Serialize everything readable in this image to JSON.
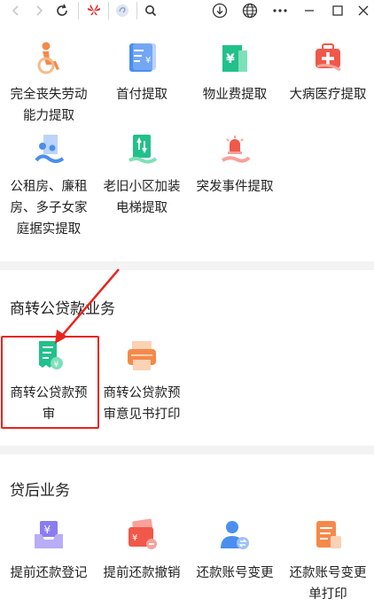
{
  "toolbar": {
    "icons": [
      "back-arrow-icon",
      "forward-arrow-icon",
      "reload-icon",
      "huawei-logo-icon",
      "spiral-logo-icon",
      "search-icon",
      "download-icon",
      "globe-icon",
      "more-icon",
      "minimize-icon",
      "maximize-icon",
      "close-icon"
    ]
  },
  "section1": {
    "row1": [
      {
        "label": "完全丧失劳动能力提取",
        "icon": "wheelchair-icon"
      },
      {
        "label": "首付提取",
        "icon": "yen-document-icon"
      },
      {
        "label": "物业费提取",
        "icon": "yen-building-icon"
      },
      {
        "label": "大病医疗提取",
        "icon": "medical-kit-icon"
      }
    ],
    "row2": [
      {
        "label": "公租房、廉租房、多子女家庭据实提取",
        "icon": "housing-family-icon"
      },
      {
        "label": "老旧小区加装电梯提取",
        "icon": "elevator-icon"
      },
      {
        "label": "突发事件提取",
        "icon": "alarm-hand-icon"
      }
    ]
  },
  "section2": {
    "title": "商转公贷款业务",
    "items": [
      {
        "label": "商转公贷款预审",
        "icon": "receipt-yen-icon"
      },
      {
        "label": "商转公贷款预审意见书打印",
        "icon": "printer-icon"
      }
    ]
  },
  "section3": {
    "title": "贷后业务",
    "items": [
      {
        "label": "提前还款登记",
        "icon": "yen-inbox-icon"
      },
      {
        "label": "提前还款撤销",
        "icon": "card-cancel-icon"
      },
      {
        "label": "还款账号变更",
        "icon": "user-exchange-icon"
      },
      {
        "label": "还款账号变更单打印",
        "icon": "document-print-icon"
      }
    ]
  },
  "colors": {
    "orange": "#f5894a",
    "blue": "#4a8ef0",
    "teal": "#22c08a",
    "red_highlight": "#e8231d",
    "purple": "#8b7cf0"
  }
}
